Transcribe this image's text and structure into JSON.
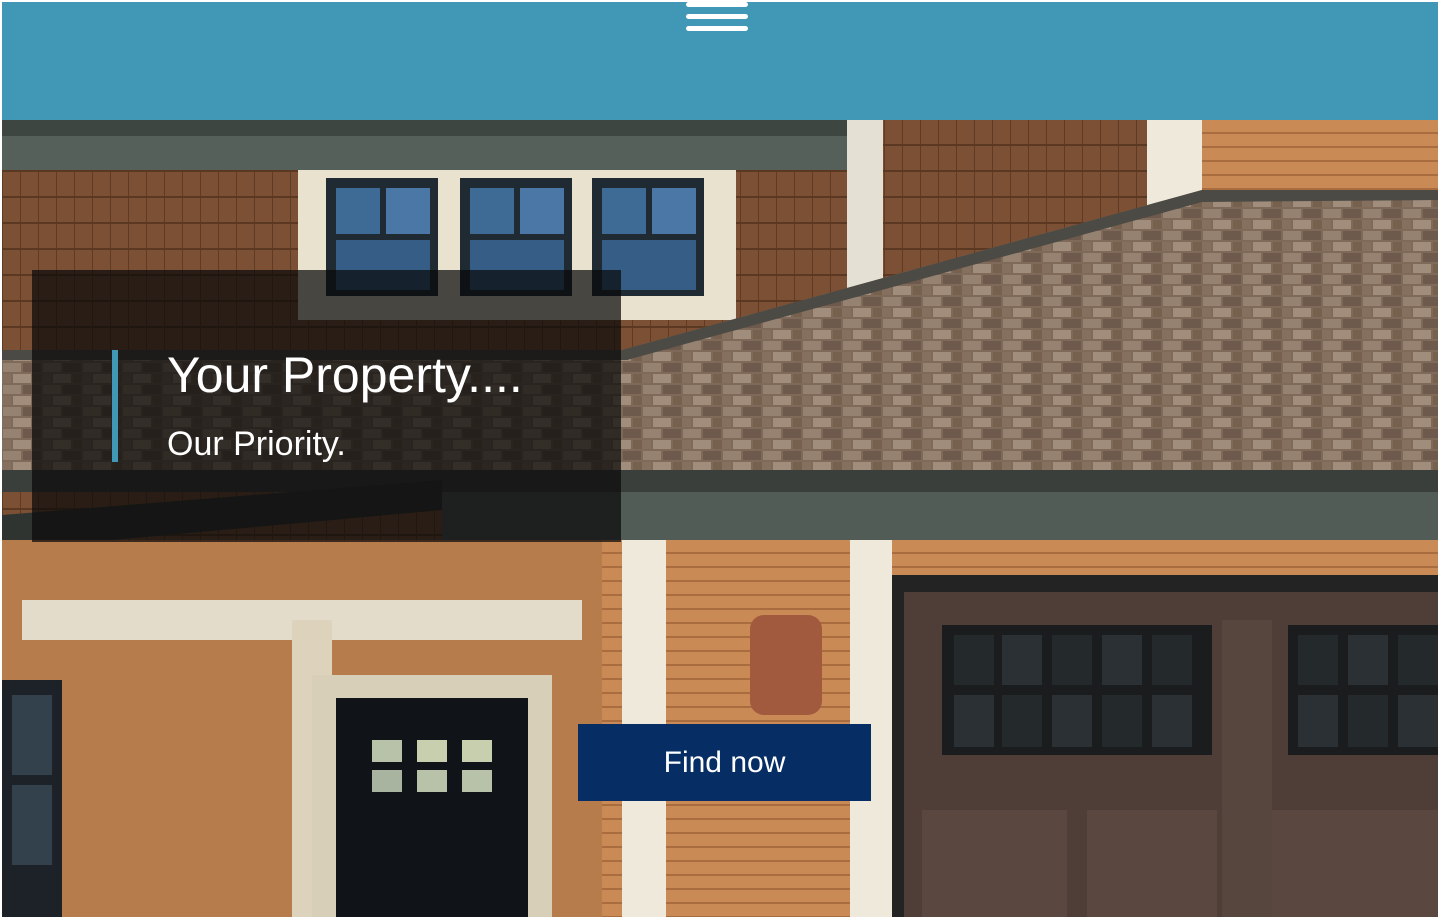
{
  "header": {
    "menu_icon": "hamburger-menu-icon",
    "background_color": "#4197b6"
  },
  "hero": {
    "background_description_icon": "house-photo",
    "title": "Your Property....",
    "subtitle": "Our Priority.",
    "accent_color": "#4197b6",
    "cta_label": "Find now",
    "cta_color": "#062d64"
  }
}
